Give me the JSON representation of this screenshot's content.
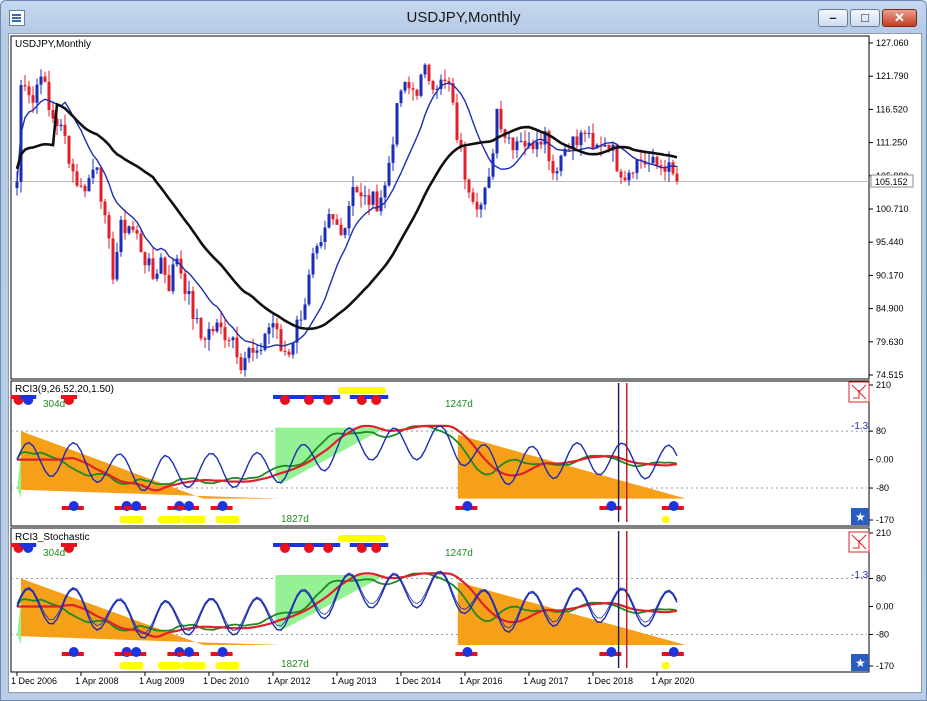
{
  "window": {
    "title": "USDJPY,Monthly"
  },
  "icons": {
    "app": "chart-window-icon",
    "minimize": "minimize-icon",
    "maximize": "maximize-icon",
    "close": "close-icon"
  },
  "colors": {
    "price_bull": "#1a2db5",
    "price_bear": "#e0202a",
    "ma_fast": "#1a2db5",
    "ma_slow": "#101010",
    "rci_short": "#1a2db5",
    "rci_mid": "#e0202a",
    "rci_long": "#1f8a1f",
    "down_fill": "#f59a0c",
    "up_fill": "#8ef08e",
    "dot_red": "#e8101a",
    "dot_blue": "#1a35e0",
    "bar_yellow": "#ffff00"
  },
  "chart_data": [
    {
      "type": "candlestick",
      "title": "USDJPY,Monthly",
      "ylim": [
        74.515,
        127.06
      ],
      "yticks": [
        "127.060",
        "121.790",
        "116.520",
        "111.250",
        "105.980",
        "100.710",
        "95.440",
        "90.170",
        "84.900",
        "79.630",
        "74.515"
      ],
      "current_price": "105.152",
      "current_value": 105.152,
      "x_labels": [
        "1 Dec 2006",
        "1 Apr 2008",
        "1 Aug 2009",
        "1 Dec 2010",
        "1 Apr 2012",
        "1 Aug 2013",
        "1 Dec 2014",
        "1 Apr 2016",
        "1 Aug 2017",
        "1 Dec 2018",
        "1 Apr 2020"
      ],
      "monthly_close": [
        [
          2006.92,
          118.9
        ],
        [
          2007.08,
          121.5
        ],
        [
          2007.25,
          117.8
        ],
        [
          2007.42,
          123.2
        ],
        [
          2007.58,
          116.2
        ],
        [
          2007.75,
          114.6
        ],
        [
          2007.92,
          111.8
        ],
        [
          2008.08,
          106.8
        ],
        [
          2008.25,
          103.9
        ],
        [
          2008.42,
          105.5
        ],
        [
          2008.58,
          108.6
        ],
        [
          2008.75,
          98.4
        ],
        [
          2008.92,
          90.7
        ],
        [
          2009.08,
          97.6
        ],
        [
          2009.25,
          98.3
        ],
        [
          2009.42,
          96.3
        ],
        [
          2009.58,
          93.0
        ],
        [
          2009.75,
          89.9
        ],
        [
          2009.92,
          93.0
        ],
        [
          2010.08,
          88.8
        ],
        [
          2010.25,
          93.4
        ],
        [
          2010.42,
          88.6
        ],
        [
          2010.58,
          84.3
        ],
        [
          2010.75,
          80.4
        ],
        [
          2010.92,
          81.5
        ],
        [
          2011.08,
          82.0
        ],
        [
          2011.25,
          81.2
        ],
        [
          2011.42,
          80.6
        ],
        [
          2011.58,
          76.7
        ],
        [
          2011.75,
          78.2
        ],
        [
          2011.92,
          76.9
        ],
        [
          2012.08,
          81.2
        ],
        [
          2012.25,
          82.9
        ],
        [
          2012.42,
          78.4
        ],
        [
          2012.58,
          78.4
        ],
        [
          2012.75,
          82.5
        ],
        [
          2012.92,
          86.5
        ],
        [
          2013.08,
          92.6
        ],
        [
          2013.25,
          94.2
        ],
        [
          2013.42,
          99.3
        ],
        [
          2013.58,
          98.1
        ],
        [
          2013.75,
          98.3
        ],
        [
          2013.92,
          105.3
        ],
        [
          2014.08,
          102.2
        ],
        [
          2014.25,
          102.2
        ],
        [
          2014.42,
          102.0
        ],
        [
          2014.58,
          104.1
        ],
        [
          2014.75,
          112.3
        ],
        [
          2014.92,
          119.8
        ],
        [
          2015.08,
          119.6
        ],
        [
          2015.25,
          119.9
        ],
        [
          2015.42,
          122.4
        ],
        [
          2015.58,
          121.2
        ],
        [
          2015.75,
          120.6
        ],
        [
          2015.92,
          120.2
        ],
        [
          2016.08,
          112.7
        ],
        [
          2016.25,
          106.5
        ],
        [
          2016.42,
          103.2
        ],
        [
          2016.58,
          101.3
        ],
        [
          2016.75,
          104.8
        ],
        [
          2016.92,
          116.9
        ],
        [
          2017.08,
          112.8
        ],
        [
          2017.25,
          111.5
        ],
        [
          2017.42,
          112.4
        ],
        [
          2017.58,
          110.3
        ],
        [
          2017.75,
          112.5
        ],
        [
          2017.92,
          112.7
        ],
        [
          2018.08,
          106.7
        ],
        [
          2018.25,
          109.3
        ],
        [
          2018.42,
          111.9
        ],
        [
          2018.58,
          111.0
        ],
        [
          2018.75,
          113.2
        ],
        [
          2018.92,
          109.6
        ],
        [
          2019.08,
          111.4
        ],
        [
          2019.25,
          111.4
        ],
        [
          2019.42,
          108.0
        ],
        [
          2019.58,
          106.3
        ],
        [
          2019.75,
          108.0
        ],
        [
          2019.92,
          108.6
        ],
        [
          2020.08,
          107.9
        ],
        [
          2020.25,
          107.6
        ],
        [
          2020.42,
          107.9
        ],
        [
          2020.58,
          105.9
        ],
        [
          2020.67,
          105.15
        ]
      ]
    },
    {
      "type": "line",
      "title": "RCI3(9,26,52,20,1.50)",
      "ylim": [
        -170,
        210
      ],
      "yticks": [
        "210",
        "80",
        "0.00",
        "-80",
        "-170"
      ],
      "level_label": "-1.3",
      "annotations": [
        "304d",
        "1247d",
        "1827d"
      ]
    },
    {
      "type": "line",
      "title": "RCI3_Stochastic",
      "ylim": [
        -170,
        210
      ],
      "yticks": [
        "210",
        "80",
        "0.00",
        "-80",
        "-170"
      ],
      "level_label": "-1.3",
      "annotations": [
        "304d",
        "1247d",
        "1827d"
      ]
    }
  ]
}
